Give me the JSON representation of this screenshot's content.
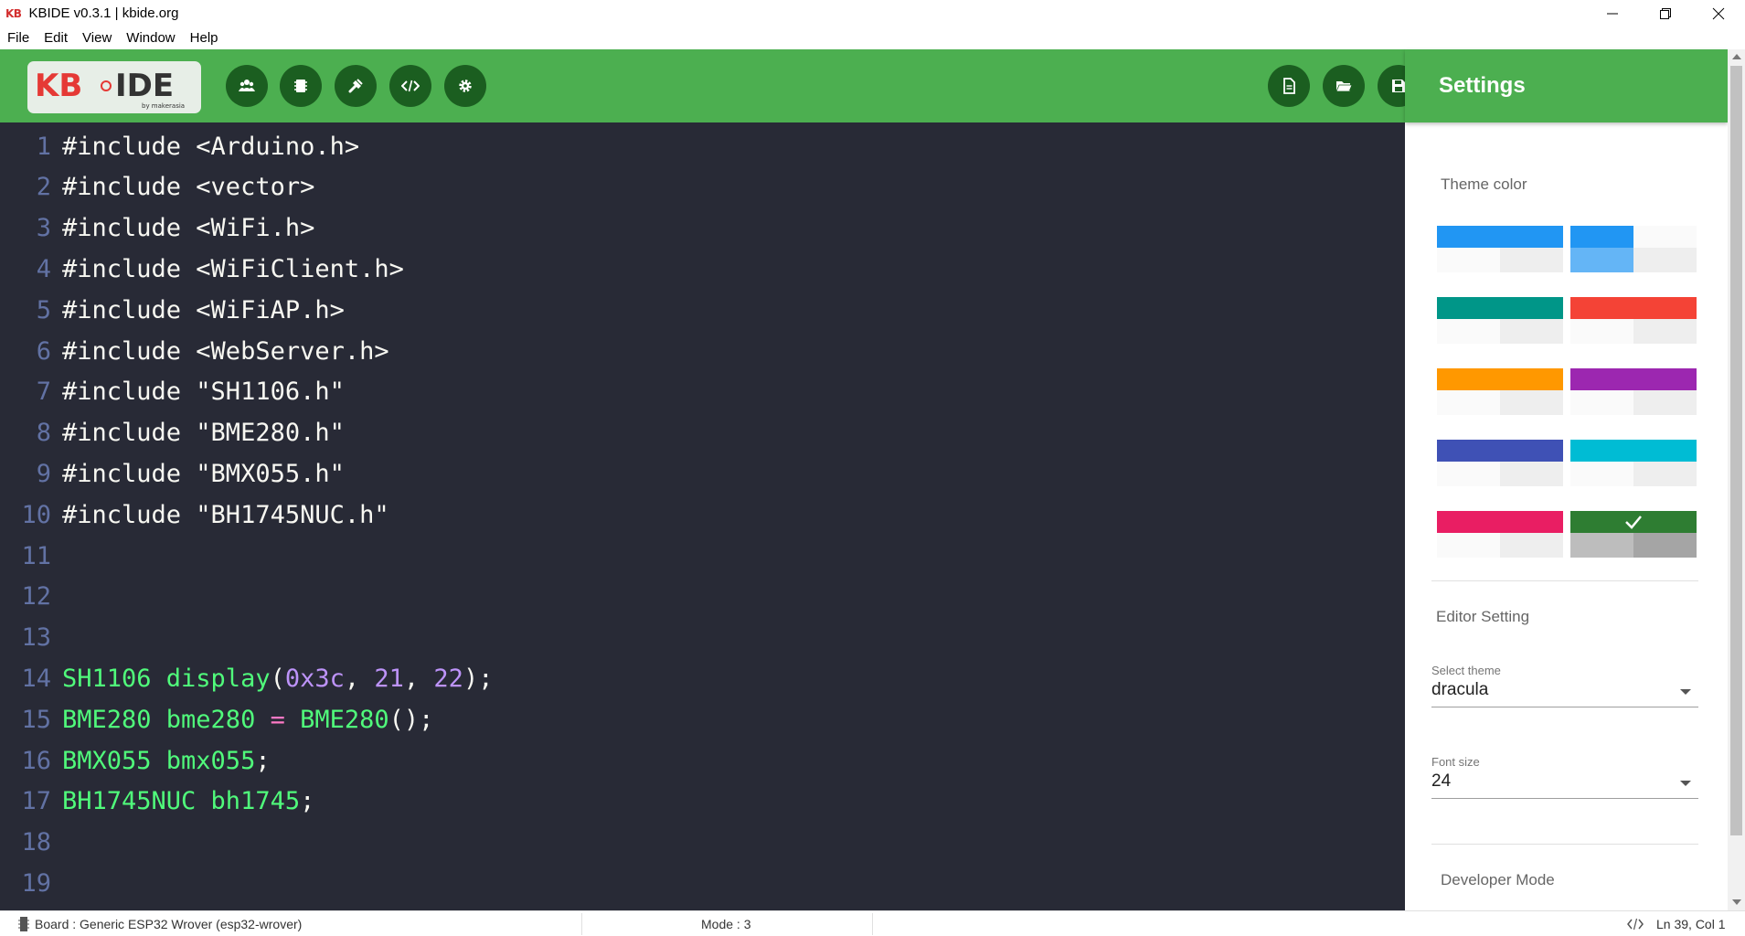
{
  "window": {
    "app_mark": "KB",
    "title": "KBIDE v0.3.1 | kbide.org",
    "controls": [
      "minimize-icon",
      "restore-icon",
      "close-icon"
    ]
  },
  "menu": [
    "File",
    "Edit",
    "View",
    "Window",
    "Help"
  ],
  "logo": {
    "text_left": "KB",
    "text_right": "IDE",
    "byline": "by makerasia"
  },
  "toolbar": {
    "left_buttons": [
      "users-icon",
      "board-icon",
      "plugin-icon",
      "code-icon",
      "gear-icon"
    ],
    "right_buttons": [
      "new-file-icon",
      "open-folder-icon",
      "save-icon"
    ]
  },
  "editor": {
    "lines": [
      {
        "n": "1",
        "tokens": [
          {
            "t": "#include <Arduino.h>",
            "c": ""
          }
        ]
      },
      {
        "n": "2",
        "tokens": [
          {
            "t": "#include <vector>",
            "c": ""
          }
        ]
      },
      {
        "n": "3",
        "tokens": [
          {
            "t": "#include <WiFi.h>",
            "c": ""
          }
        ]
      },
      {
        "n": "4",
        "tokens": [
          {
            "t": "#include <WiFiClient.h>",
            "c": ""
          }
        ]
      },
      {
        "n": "5",
        "tokens": [
          {
            "t": "#include <WiFiAP.h>",
            "c": ""
          }
        ]
      },
      {
        "n": "6",
        "tokens": [
          {
            "t": "#include <WebServer.h>",
            "c": ""
          }
        ]
      },
      {
        "n": "7",
        "tokens": [
          {
            "t": "#include \"SH1106.h\"",
            "c": ""
          }
        ]
      },
      {
        "n": "8",
        "tokens": [
          {
            "t": "#include \"BME280.h\"",
            "c": ""
          }
        ]
      },
      {
        "n": "9",
        "tokens": [
          {
            "t": "#include \"BMX055.h\"",
            "c": ""
          }
        ]
      },
      {
        "n": "10",
        "tokens": [
          {
            "t": "#include \"BH1745NUC.h\"",
            "c": ""
          }
        ]
      },
      {
        "n": "11",
        "tokens": []
      },
      {
        "n": "12",
        "tokens": []
      },
      {
        "n": "13",
        "tokens": []
      },
      {
        "n": "14",
        "tokens": [
          {
            "t": "SH1106 display",
            "c": "c-def"
          },
          {
            "t": "(",
            "c": ""
          },
          {
            "t": "0x3c",
            "c": "c-num"
          },
          {
            "t": ", ",
            "c": ""
          },
          {
            "t": "21",
            "c": "c-num"
          },
          {
            "t": ", ",
            "c": ""
          },
          {
            "t": "22",
            "c": "c-num"
          },
          {
            "t": ");",
            "c": ""
          }
        ]
      },
      {
        "n": "15",
        "tokens": [
          {
            "t": "BME280 bme280 ",
            "c": "c-def"
          },
          {
            "t": "=",
            "c": "c-op"
          },
          {
            "t": " ",
            "c": ""
          },
          {
            "t": "BME280",
            "c": "c-def"
          },
          {
            "t": "();",
            "c": ""
          }
        ]
      },
      {
        "n": "16",
        "tokens": [
          {
            "t": "BMX055 bmx055",
            "c": "c-def"
          },
          {
            "t": ";",
            "c": ""
          }
        ]
      },
      {
        "n": "17",
        "tokens": [
          {
            "t": "BH1745NUC bh1745",
            "c": "c-def"
          },
          {
            "t": ";",
            "c": ""
          }
        ]
      },
      {
        "n": "18",
        "tokens": []
      },
      {
        "n": "19",
        "tokens": []
      }
    ]
  },
  "settings": {
    "title": "Settings",
    "theme_color_label": "Theme color",
    "swatches": [
      {
        "color": "#2196f3",
        "style": "full",
        "selected": false
      },
      {
        "color": "#2196f3",
        "style": "split",
        "light": "#64b5f6",
        "selected": false
      },
      {
        "color": "#009688",
        "style": "full",
        "selected": false
      },
      {
        "color": "#f44336",
        "style": "full",
        "selected": false
      },
      {
        "color": "#ff9800",
        "style": "full",
        "selected": false
      },
      {
        "color": "#9c27b0",
        "style": "full",
        "selected": false
      },
      {
        "color": "#3f51b5",
        "style": "full",
        "selected": false
      },
      {
        "color": "#00bcd4",
        "style": "full",
        "selected": false
      },
      {
        "color": "#e91e63",
        "style": "full",
        "selected": false
      },
      {
        "color": "#2e7d32",
        "style": "selected",
        "selected": true
      }
    ],
    "editor_setting_label": "Editor Setting",
    "select_theme": {
      "label": "Select theme",
      "value": "dracula"
    },
    "font_size": {
      "label": "Font size",
      "value": "24"
    },
    "developer_mode_label": "Developer Mode"
  },
  "status": {
    "board": "Board : Generic ESP32 Wrover (esp32-wrover)",
    "mode": "Mode : 3",
    "position": "Ln 39, Col 1"
  },
  "colors": {
    "accent": "#4caf50",
    "toolbar_button": "#1b5e20",
    "editor_bg": "#282a36"
  }
}
